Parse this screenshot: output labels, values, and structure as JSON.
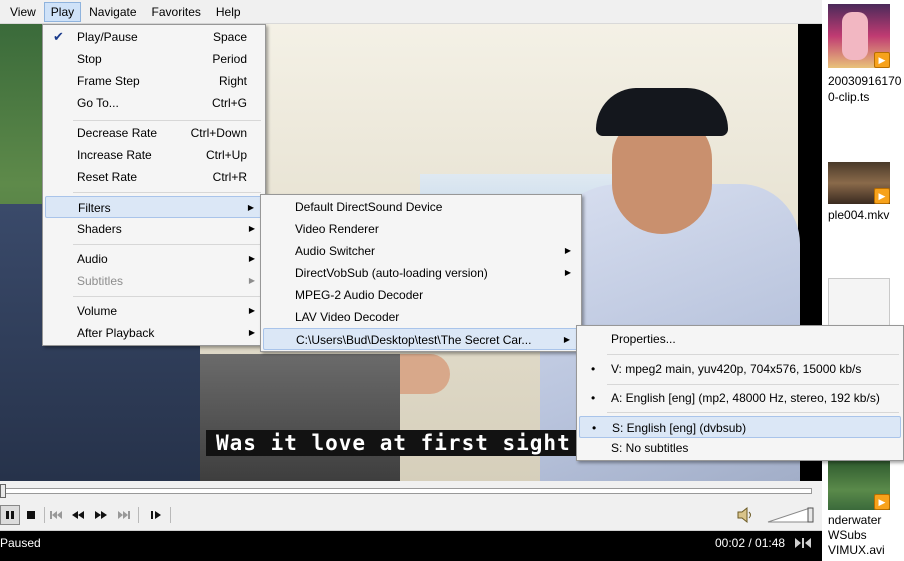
{
  "menubar": [
    "View",
    "Play",
    "Navigate",
    "Favorites",
    "Help"
  ],
  "play_menu": {
    "items": [
      {
        "label": "Play/Pause",
        "shortcut": "Space",
        "checked": true
      },
      {
        "label": "Stop",
        "shortcut": "Period"
      },
      {
        "label": "Frame Step",
        "shortcut": "Right"
      },
      {
        "label": "Go To...",
        "shortcut": "Ctrl+G"
      },
      {
        "label": "Decrease Rate",
        "shortcut": "Ctrl+Down"
      },
      {
        "label": "Increase Rate",
        "shortcut": "Ctrl+Up"
      },
      {
        "label": "Reset Rate",
        "shortcut": "Ctrl+R"
      },
      {
        "label": "Filters",
        "submenu": true,
        "highlight": true
      },
      {
        "label": "Shaders",
        "submenu": true
      },
      {
        "label": "Audio",
        "submenu": true
      },
      {
        "label": "Subtitles",
        "submenu": true,
        "disabled": true
      },
      {
        "label": "Volume",
        "submenu": true
      },
      {
        "label": "After Playback",
        "submenu": true
      }
    ]
  },
  "filters_menu": {
    "items": [
      {
        "label": "Default DirectSound Device"
      },
      {
        "label": "Video Renderer"
      },
      {
        "label": "Audio Switcher",
        "submenu": true
      },
      {
        "label": "DirectVobSub (auto-loading version)",
        "submenu": true
      },
      {
        "label": "MPEG-2 Audio Decoder"
      },
      {
        "label": "LAV Video Decoder"
      },
      {
        "label": "C:\\Users\\Bud\\Desktop\\test\\The Secret Car...",
        "submenu": true,
        "highlight": true
      }
    ]
  },
  "source_menu": {
    "items": [
      {
        "label": "Properties..."
      },
      {
        "label": "V: mpeg2 main, yuv420p, 704x576, 15000 kb/s",
        "bullet": true
      },
      {
        "label": "A: English [eng] (mp2, 48000 Hz, stereo, 192 kb/s)",
        "bullet": true
      },
      {
        "label": "S: English [eng] (dvbsub)",
        "bullet": true,
        "highlight": true
      },
      {
        "label": "S: No subtitles"
      }
    ]
  },
  "video": {
    "subtitle": "Was it love at first sight"
  },
  "status": {
    "state": "Paused",
    "time": "00:02 / 01:48"
  },
  "desktop": {
    "files": [
      {
        "label_lines": [
          "20030916170",
          "0-clip.ts"
        ]
      },
      {
        "label_lines": [
          "ple004.mkv"
        ]
      },
      {
        "label_lines": [
          "nderwater",
          "WSubs",
          "VIMUX.avi"
        ]
      }
    ]
  },
  "colors": {
    "menu_highlight": "#dbe7f6",
    "menu_border": "#979797",
    "player_background": "#000000",
    "thumb_play": "#f7a21b"
  }
}
